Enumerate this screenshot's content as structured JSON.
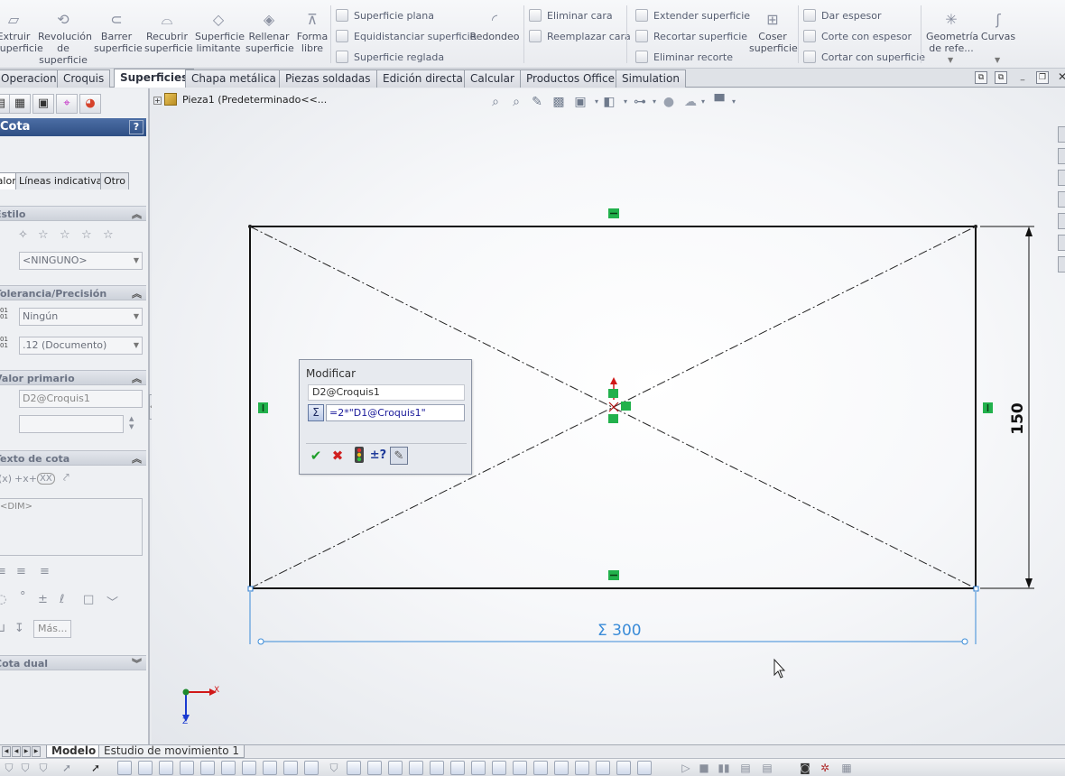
{
  "ribbon": {
    "extrude": "Extruir superficie",
    "revolve": "Revolución de superficie",
    "sweep": "Barrer superficie",
    "loft": "Recubrir superficie",
    "boundary": "Superficie limitante",
    "fill": "Rellenar superficie",
    "freeform": "Forma libre",
    "planar": "Superficie plana",
    "offset": "Equidistanciar superficie",
    "ruled": "Superficie reglada",
    "fillet": "Redondeo",
    "delete_face": "Eliminar cara",
    "replace_face": "Reemplazar cara",
    "extend": "Extender superficie",
    "trim": "Recortar superficie",
    "untrim": "Eliminar recorte",
    "knit": "Coser superficie",
    "thicken": "Dar espesor",
    "thicken_cut": "Corte con espesor",
    "surface_cut": "Cortar con superficie",
    "ref_geometry": "Geometría de refe...",
    "curves": "Curvas"
  },
  "tabs": [
    {
      "label": "Operaciones",
      "active": false
    },
    {
      "label": "Croquis",
      "active": false
    },
    {
      "label": "Superficies",
      "active": true
    },
    {
      "label": "Chapa metálica",
      "active": false
    },
    {
      "label": "Piezas soldadas",
      "active": false
    },
    {
      "label": "Edición directa",
      "active": false
    },
    {
      "label": "Calcular",
      "active": false
    },
    {
      "label": "Productos Office",
      "active": false
    },
    {
      "label": "Simulation",
      "active": false
    }
  ],
  "panel": {
    "title": "Cota",
    "help": "?",
    "subtabs": [
      "Valor",
      "Líneas indicativas",
      "Otro"
    ],
    "style_section": "Estilo",
    "style_combo": "<NINGUNO>",
    "tolerance_section": "Tolerancia/Precisión",
    "tolerance_combo": "Ningún",
    "precision_combo": ".12 (Documento)",
    "primary_value_section": "Valor primario",
    "primary_value_name": "D2@Croquis1",
    "primary_value_input": "",
    "dim_text_section": "Texto de cota",
    "dim_text_area": "<DIM>",
    "dual_dim_section": "Cota dual",
    "more_button": "Más...",
    "pglyph_10": "01",
    "pglyph_11": "01",
    "pglyph_12": "01",
    "pglyph_13": "01"
  },
  "tree": {
    "root": "Pieza1  (Predeterminado<<..."
  },
  "modify": {
    "title": "Modificar",
    "name": "D2@Croquis1",
    "value": "=2*\"D1@Croquis1\""
  },
  "dims": {
    "width": "300",
    "height": "150",
    "width_prefix": "Σ"
  },
  "axes": {
    "x": "X",
    "y": "Z"
  },
  "bottom_tabs": [
    {
      "label": "Modelo",
      "active": true
    },
    {
      "label": "Estudio de movimiento 1",
      "active": false
    }
  ],
  "colors": {
    "accent": "#2f4f84",
    "dimension_blue": "#3a8bd8",
    "relation_green": "#22b14c"
  }
}
